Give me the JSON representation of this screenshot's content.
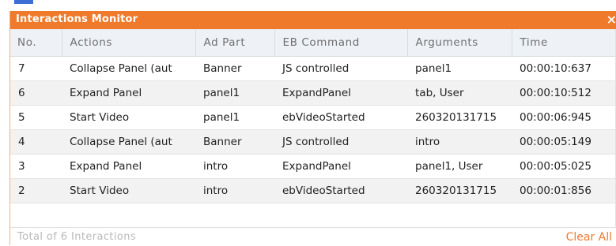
{
  "window": {
    "title": "Interactions Monitor",
    "close_glyph": "×"
  },
  "table": {
    "headers": [
      "No.",
      "Actions",
      "Ad Part",
      "EB Command",
      "Arguments",
      "Time"
    ],
    "rows": [
      [
        "7",
        "Collapse Panel (aut",
        "Banner",
        "JS controlled",
        "panel1",
        "00:00:10:637"
      ],
      [
        "6",
        "Expand Panel",
        "panel1",
        "ExpandPanel",
        "tab, User",
        "00:00:10:512"
      ],
      [
        "5",
        "Start Video",
        "panel1",
        "ebVideoStarted",
        "260320131715",
        "00:00:06:945"
      ],
      [
        "4",
        "Collapse Panel (aut",
        "Banner",
        "JS controlled",
        "intro",
        "00:00:05:149"
      ],
      [
        "3",
        "Expand Panel",
        "intro",
        "ExpandPanel",
        "panel1, User",
        "00:00:05:025"
      ],
      [
        "2",
        "Start Video",
        "intro",
        "ebVideoStarted",
        "260320131715",
        "00:00:01:856"
      ]
    ]
  },
  "footer": {
    "total_text": "Total of 6 Interactions",
    "clear_all_label": "Clear All"
  },
  "colors": {
    "accent": "#ef7a2c",
    "header_bg": "#eef2f6",
    "tab_blue": "#3b6fd6"
  }
}
